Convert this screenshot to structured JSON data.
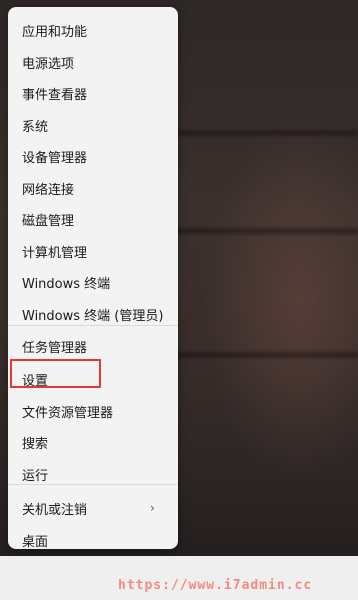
{
  "menu": {
    "items": [
      {
        "label": "应用和功能"
      },
      {
        "label": "电源选项"
      },
      {
        "label": "事件查看器"
      },
      {
        "label": "系统"
      },
      {
        "label": "设备管理器"
      },
      {
        "label": "网络连接"
      },
      {
        "label": "磁盘管理"
      },
      {
        "label": "计算机管理"
      },
      {
        "label": "Windows 终端"
      },
      {
        "label": "Windows 终端 (管理员)"
      },
      {
        "label": "任务管理器"
      },
      {
        "label": "设置"
      },
      {
        "label": "文件资源管理器"
      },
      {
        "label": "搜索"
      },
      {
        "label": "运行"
      },
      {
        "label": "关机或注销"
      },
      {
        "label": "桌面"
      }
    ],
    "submenu_arrow": "›"
  },
  "highlight": {
    "color": "#e53935",
    "target": "设置"
  },
  "watermark": "https://www.i7admin.cc"
}
